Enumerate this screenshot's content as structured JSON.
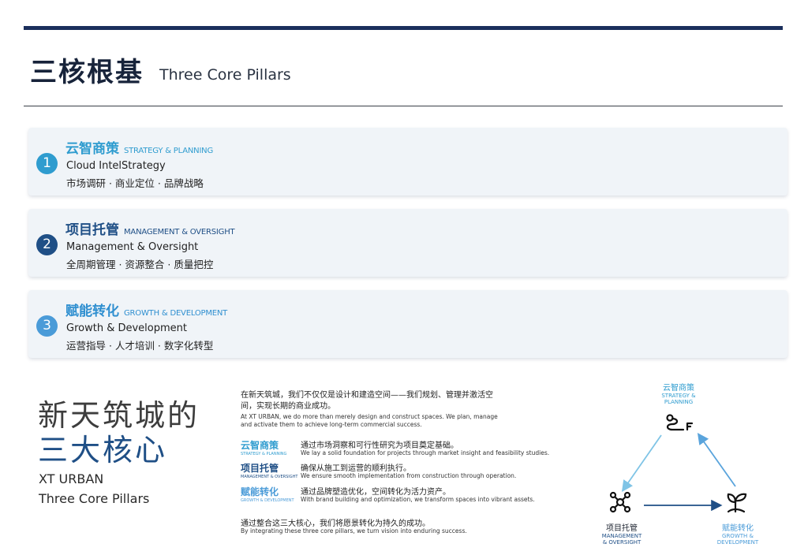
{
  "header": {
    "title_zh": "三核根基",
    "title_en": "Three Core Pillars"
  },
  "colors": {
    "navy": "#1b2f5c",
    "teal": "#2f9ccf",
    "dark_blue": "#1f4f86",
    "light_blue": "#4a9bd8",
    "card_bg": "#f0f4f8"
  },
  "pillars": [
    {
      "number": "1",
      "title_zh": "云智商策",
      "tag": "STRATEGY & PLANNING",
      "title_en": "Cloud IntelStrategy",
      "sub": "市场调研 · 商业定位 · 品牌战略",
      "color": "#2f9ccf"
    },
    {
      "number": "2",
      "title_zh": "项目托管",
      "tag": "MANAGEMENT & OVERSIGHT",
      "title_en": "Management & Oversight",
      "sub": "全周期管理 · 资源整合 · 质量把控",
      "color": "#1f4f86"
    },
    {
      "number": "3",
      "title_zh": "赋能转化",
      "tag": "GROWTH & DEVELOPMENT",
      "title_en": "Growth & Development",
      "sub": "运营指导 · 人才培训 · 数字化转型",
      "color": "#4a9bd8"
    }
  ],
  "feature": {
    "line1_zh": "新天筑城的",
    "line2_zh": "三大核心",
    "line1_en": "XT URBAN",
    "line2_en": "Three Core Pillars"
  },
  "intro": {
    "zh": "在新天筑城，我们不仅仅是设计和建造空间——我们规划、管理并激活空间，实现长期的商业成功。",
    "en": "At XT URBAN, we do more than merely design and construct spaces. We plan, manage and activate them to achieve long-term commercial success."
  },
  "rows": [
    {
      "title_zh": "云智商策",
      "tag": "STRATEGY & PLANNING",
      "desc_zh": "通过市场洞察和可行性研究为项目奠定基础。",
      "desc_en": "We lay a solid foundation for projects through market insight and feasibility studies.",
      "color": "#2f9ccf"
    },
    {
      "title_zh": "项目托管",
      "tag": "MANAGEMENT & OVERSIGHT",
      "desc_zh": "确保从施工到运营的顺利执行。",
      "desc_en": "We ensure smooth implementation from construction through operation.",
      "color": "#1f4f86"
    },
    {
      "title_zh": "赋能转化",
      "tag": "GROWTH & DEVELOPMENT",
      "desc_zh": "通过品牌塑造优化，空间转化为活力资产。",
      "desc_en": "With brand building and optimization, we transform spaces into vibrant assets.",
      "color": "#4a9bd8"
    }
  ],
  "outro": {
    "zh": "通过整合这三大核心，我们将愿景转化为持久的成功。",
    "en": "By integrating these three core pillars, we turn vision into enduring success."
  },
  "diagram": {
    "top": {
      "zh": "云智商策",
      "en1": "STRATEGY &",
      "en2": "PLANNING",
      "icon": "path-route-icon"
    },
    "left": {
      "zh": "项目托管",
      "en1": "MANAGEMENT",
      "en2": "& OVERSIGHT",
      "icon": "network-nodes-icon"
    },
    "right": {
      "zh": "赋能转化",
      "en1": "GROWTH &",
      "en2": "DEVELOPMENT",
      "icon": "sprout-icon"
    }
  }
}
